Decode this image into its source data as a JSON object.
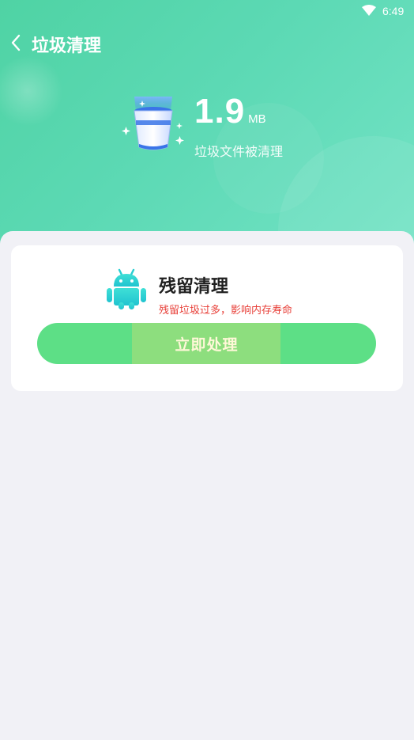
{
  "status_bar": {
    "time": "6:49"
  },
  "header": {
    "title": "垃圾清理"
  },
  "summary": {
    "size_value": "1.9",
    "size_unit": "MB",
    "caption": "垃圾文件被清理"
  },
  "card": {
    "title": "残留清理",
    "subtitle": "残留垃圾过多，影响内存寿命",
    "button_label": "立即处理"
  },
  "colors": {
    "header_gradient_start": "#4fd3a4",
    "header_gradient_end": "#74e3c6",
    "button_green": "#5ddf86",
    "warning_red": "#e8413a",
    "background": "#f1f1f6"
  },
  "icons": [
    "wifi-icon",
    "back-arrow-icon",
    "trash-bin-icon",
    "android-icon"
  ]
}
